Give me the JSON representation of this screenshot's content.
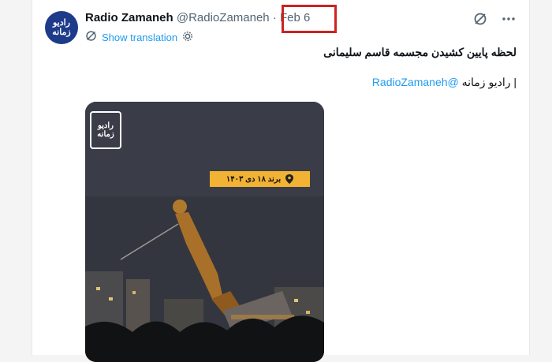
{
  "account": {
    "avatar_line1": "رادیو",
    "avatar_line2": "زمانه",
    "name": "Radio Zamaneh",
    "handle": "@RadioZamaneh",
    "separator": " · ",
    "date": "Feb 6"
  },
  "translate": {
    "label": "Show translation"
  },
  "icons": {
    "grok": "grok-icon",
    "more": "more-icon",
    "translate": "translate-icon",
    "settings": "settings-icon",
    "location": "location-pin-icon"
  },
  "tweet": {
    "line1": "لحظه پایین کشیدن مجسمه قاسم سلیمانی",
    "line2_mention": "@RadioZamaneh",
    "line2_text": " | رادیو زمانه"
  },
  "media": {
    "watermark_line1": "رادیو",
    "watermark_line2": "زمانه",
    "location_tag": "برند ۱۸ دی ۱۴۰۳"
  },
  "colors": {
    "accent": "#1d9bf0",
    "highlight_box": "#cc2222",
    "tag_bg": "#f2b233"
  }
}
